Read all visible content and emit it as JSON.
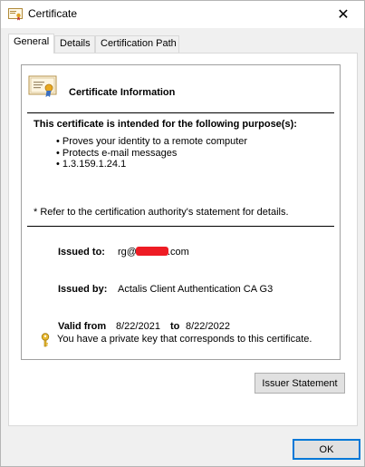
{
  "window": {
    "title": "Certificate",
    "close_glyph": "✕"
  },
  "tabs": [
    {
      "label": "General",
      "active": true
    },
    {
      "label": "Details",
      "active": false
    },
    {
      "label": "Certification Path",
      "active": false
    }
  ],
  "info": {
    "heading": "Certificate Information",
    "purpose_heading": "This certificate is intended for the following purpose(s):",
    "purposes": [
      "Proves your identity to a remote computer",
      "Protects e-mail messages",
      "1.3.159.1.24.1"
    ],
    "refer_note": "* Refer to the certification authority's statement for details."
  },
  "fields": {
    "issued_to_label": "Issued to:",
    "issued_to_prefix": "rg@",
    "issued_to_suffix": ".com",
    "issued_by_label": "Issued by:",
    "issued_by_value": "Actalis Client Authentication CA G3",
    "valid_from_label": "Valid from",
    "valid_from_value": "8/22/2021",
    "valid_to_label": "to",
    "valid_to_value": "8/22/2022"
  },
  "private_key_note": "You have a private key that corresponds to this certificate.",
  "buttons": {
    "issuer_statement": "Issuer Statement",
    "ok": "OK"
  },
  "colors": {
    "accent": "#0078d7",
    "redaction": "#ee1c24",
    "key": "#e8b830"
  }
}
